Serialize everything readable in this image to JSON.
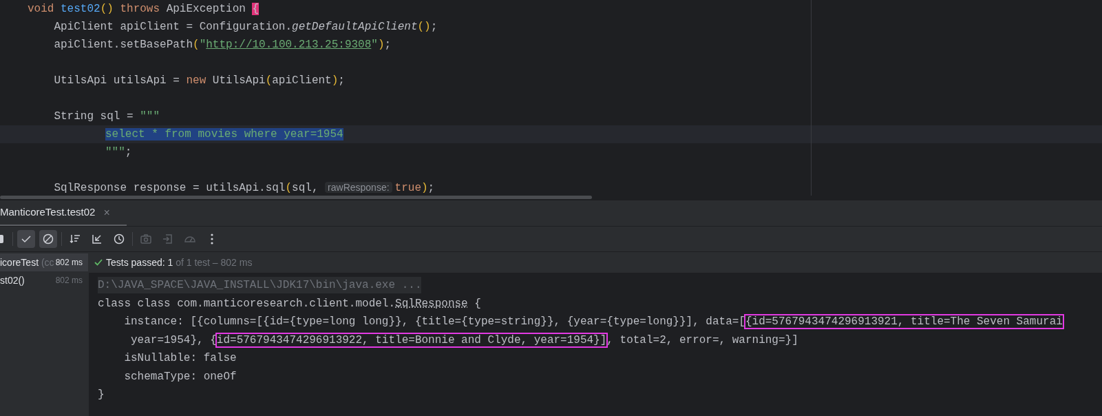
{
  "editor": {
    "lines": [
      {
        "tokens": [
          {
            "text": "void ",
            "kind": "keyword"
          },
          {
            "text": "test02",
            "kind": "fn"
          },
          {
            "text": "() ",
            "kind": "bracket"
          },
          {
            "text": "throws ",
            "kind": "keyword"
          },
          {
            "text": "ApiException ",
            "kind": "plain"
          },
          {
            "text": "{",
            "kind": "brace-match"
          }
        ]
      },
      {
        "tokens": [
          {
            "text": "    ApiClient apiClient = Configuration.",
            "kind": "plain"
          },
          {
            "text": "getDefaultApiClient",
            "kind": "static"
          },
          {
            "text": "()",
            "kind": "bracket"
          },
          {
            "text": ";",
            "kind": "plain"
          }
        ]
      },
      {
        "tokens": [
          {
            "text": "    apiClient.setBasePath",
            "kind": "plain"
          },
          {
            "text": "(",
            "kind": "bracket"
          },
          {
            "text": "\"",
            "kind": "string"
          },
          {
            "text": "http://10.100.213.25:9308",
            "kind": "link"
          },
          {
            "text": "\"",
            "kind": "string"
          },
          {
            "text": ")",
            "kind": "bracket"
          },
          {
            "text": ";",
            "kind": "plain"
          }
        ]
      },
      {
        "kind": "blank"
      },
      {
        "tokens": [
          {
            "text": "    UtilsApi utilsApi = ",
            "kind": "plain"
          },
          {
            "text": "new ",
            "kind": "keyword"
          },
          {
            "text": "UtilsApi",
            "kind": "plain"
          },
          {
            "text": "(",
            "kind": "bracket"
          },
          {
            "text": "apiClient",
            "kind": "plain"
          },
          {
            "text": ")",
            "kind": "bracket"
          },
          {
            "text": ";",
            "kind": "plain"
          }
        ]
      },
      {
        "kind": "blank"
      },
      {
        "tokens": [
          {
            "text": "    String sql = ",
            "kind": "plain"
          },
          {
            "text": "\"\"\"",
            "kind": "string"
          }
        ]
      },
      {
        "current": true,
        "kind": "text-block",
        "tokens": [
          {
            "text": "select * from movies where year=1954",
            "kind": "selected"
          }
        ]
      },
      {
        "current": false,
        "kind": "text-block",
        "tokens": [
          {
            "text": "\"\"\"",
            "kind": "string"
          },
          {
            "text": ";",
            "kind": "plain"
          }
        ]
      },
      {
        "kind": "blank"
      },
      {
        "tokens": [
          {
            "text": "    SqlResponse response = utilsApi.sql",
            "kind": "plain"
          },
          {
            "text": "(",
            "kind": "bracket"
          },
          {
            "text": "sql, ",
            "kind": "plain"
          },
          {
            "text": "rawResponse:",
            "kind": "hint"
          },
          {
            "text": "true",
            "kind": "keyword"
          },
          {
            "text": ")",
            "kind": "bracket"
          },
          {
            "text": ";",
            "kind": "plain"
          }
        ]
      }
    ]
  },
  "run_panel": {
    "tab": {
      "label": "ManticoreTest.test02",
      "close": "×",
      "selected": true
    },
    "toolbar": [
      {
        "kind": "stop",
        "on": false,
        "disabled": false
      },
      {
        "kind": "sep"
      },
      {
        "kind": "passed",
        "on": true,
        "disabled": false
      },
      {
        "kind": "ignored",
        "on": true,
        "disabled": false
      },
      {
        "kind": "sep"
      },
      {
        "kind": "sort",
        "on": false,
        "disabled": false
      },
      {
        "kind": "collapse",
        "on": false,
        "disabled": false
      },
      {
        "kind": "history",
        "on": false,
        "disabled": false
      },
      {
        "kind": "sep"
      },
      {
        "kind": "camera",
        "on": false,
        "disabled": true
      },
      {
        "kind": "import",
        "on": false,
        "disabled": true
      },
      {
        "kind": "gauge",
        "on": false,
        "disabled": true
      },
      {
        "kind": "more",
        "on": false,
        "disabled": false
      }
    ],
    "tree": [
      {
        "name": "icoreTest",
        "detail": "(cc",
        "time": "802 ms",
        "selected": true
      },
      {
        "name": "st02()",
        "time": "802 ms",
        "selected": false
      }
    ],
    "status": {
      "passed": "Tests passed: 1",
      "rest": "of 1 test – 802 ms"
    },
    "console": [
      {
        "kind": "command",
        "segments": [
          {
            "text": "D:\\JAVA_SPACE\\JAVA_INSTALL\\JDK17\\bin\\java.exe ...",
            "kind": "plain"
          }
        ]
      },
      {
        "kind": "output",
        "segments": [
          {
            "text": "class class com.manticoresearch.client.model.",
            "kind": "plain"
          },
          {
            "text": "SqlResponse",
            "kind": "link"
          },
          {
            "text": " {",
            "kind": "plain"
          }
        ]
      },
      {
        "kind": "output",
        "segments": [
          {
            "text": "    instance: [{columns=[{id={type=long long}}, {title={type=string}}, {year={type=long}}], data=[",
            "kind": "plain"
          },
          {
            "text": "{id=5767943474296913921, title=The Seven Samurai",
            "kind": "boxed"
          }
        ]
      },
      {
        "kind": "output",
        "segments": [
          {
            "text": "     year=1954}, {",
            "kind": "plain"
          },
          {
            "text": "id=5767943474296913922, title=Bonnie and Clyde, year=1954}]",
            "kind": "boxed"
          },
          {
            "text": ", total=2, error=, warning=}]",
            "kind": "plain"
          }
        ]
      },
      {
        "kind": "output",
        "segments": [
          {
            "text": "    isNullable: false",
            "kind": "plain"
          }
        ]
      },
      {
        "kind": "output",
        "segments": [
          {
            "text": "    schemaType: oneOf",
            "kind": "plain"
          }
        ]
      },
      {
        "kind": "output",
        "segments": [
          {
            "text": "}",
            "kind": "plain"
          }
        ]
      }
    ]
  }
}
